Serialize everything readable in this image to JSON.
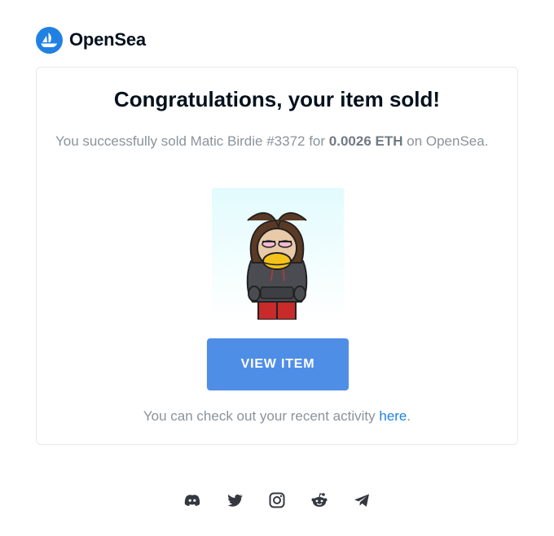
{
  "brand": {
    "name": "OpenSea",
    "accent": "#2081e2"
  },
  "email": {
    "title": "Congratulations, your item sold!",
    "description_prefix": "You successfully sold Matic Birdie #3372 for ",
    "price": "0.0026 ETH",
    "description_suffix": " on OpenSea.",
    "nft_image_alt": "Matic Birdie #3372",
    "button_label": "VIEW ITEM",
    "activity_prefix": "You can check out your recent activity ",
    "activity_link": "here",
    "activity_suffix": "."
  },
  "footer": {
    "social_icons": [
      "discord-icon",
      "twitter-icon",
      "instagram-icon",
      "reddit-icon",
      "telegram-icon"
    ]
  }
}
